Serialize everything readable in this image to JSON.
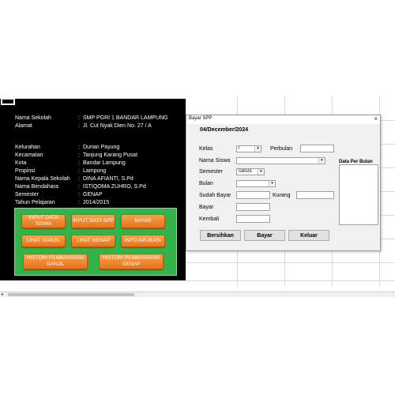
{
  "dashboard": {
    "rows": [
      {
        "label": "Nama Sekolah",
        "value": "SMP PGRI 1 BANDAR LAMPUNG"
      },
      {
        "label": "Alamat",
        "value": "Jl. Cut Nyak Dien No. 27 / A"
      },
      {
        "label": "Kelurahan",
        "value": "Durian Payung"
      },
      {
        "label": "Kecamatan",
        "value": "Tanjung Karang Pusat"
      },
      {
        "label": "Kota",
        "value": "Bandar Lampung"
      },
      {
        "label": "Propinsi",
        "value": "Lampung"
      },
      {
        "label": "Nama Kepala Sekolah",
        "value": "DINA AFIANTI, S.Pd"
      },
      {
        "label": "Nama Bendahara",
        "value": "ISTIQOMA ZUHRO, S.Pd"
      },
      {
        "label": "Semester",
        "value": "GENAP"
      },
      {
        "label": "Tahun Pelajaran",
        "value": "2014/2015"
      }
    ],
    "colon": ":",
    "menu": {
      "input_siswa": "INPUT DATA SISWA",
      "input_spp": "INPUT DATA SPP",
      "bayar": "BAYAR",
      "lihat_ganjil": "LIHAT GANJIL",
      "lihat_genap": "LIHAT GENAP",
      "info_aplikasi": "INFO APLIKASI",
      "histori_ganjil": "HISTORI PEMBAYARAN GANJIL",
      "histori_genap": "HISTORI PEMBAYARAN GENAP"
    }
  },
  "dialog": {
    "title": "Bayar SPP",
    "close": "×",
    "date": "04/December/2024",
    "labels": {
      "kelas": "Kelas",
      "perbulan": "Perbulan",
      "nama_siswa": "Nama Siswa",
      "semester": "Semester",
      "bulan": "Bulan",
      "sudah_bayar": "Sudah Bayar",
      "kurang": "Kurang",
      "bayar": "Bayar",
      "kembali": "Kembali",
      "data_per_bulan": "Data Per Bulan"
    },
    "values": {
      "kelas": "I",
      "semester": "GANJIL",
      "nama_siswa": "",
      "bulan": ""
    },
    "buttons": {
      "bersihkan": "Bersihkan",
      "bayar": "Bayar",
      "keluar": "Keluar"
    }
  },
  "icons": {
    "dropdown": "▾",
    "scroll_left": "◂"
  },
  "colors": {
    "dashboard_bg": "#000000",
    "menu_bg": "#33b349",
    "menu_button": "#e7731c"
  }
}
